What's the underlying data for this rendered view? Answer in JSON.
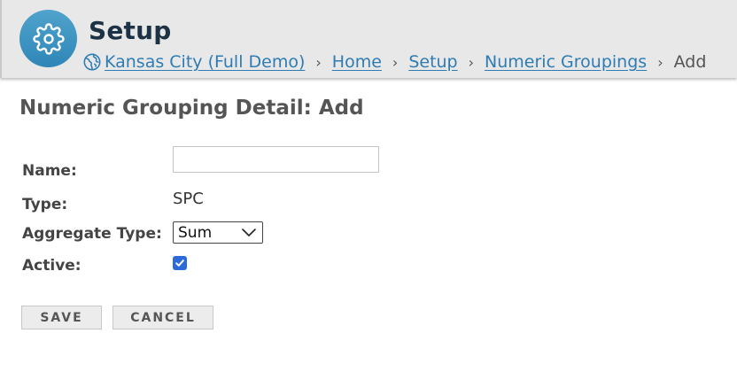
{
  "header": {
    "title": "Setup",
    "app_icon": "gear-icon",
    "breadcrumb": {
      "site_icon": "globe-icon",
      "links": [
        {
          "label": "Kansas City (Full Demo)"
        },
        {
          "label": "Home"
        },
        {
          "label": "Setup"
        },
        {
          "label": "Numeric Groupings"
        }
      ],
      "separator": "›",
      "current": "Add"
    }
  },
  "form": {
    "heading": "Numeric Grouping Detail: Add",
    "name": {
      "label": "Name:",
      "value": "",
      "placeholder": ""
    },
    "type": {
      "label": "Type:",
      "value": "SPC"
    },
    "aggregate_type": {
      "label": "Aggregate Type:",
      "selected": "Sum",
      "icon": "chevron-down-icon"
    },
    "active": {
      "label": "Active:",
      "checked": true,
      "icon": "checkmark-icon"
    }
  },
  "buttons": {
    "save": "SAVE",
    "cancel": "CANCEL"
  },
  "colors": {
    "header_bg": "#e8e8e8",
    "title": "#1e3246",
    "link": "#2e7cb3",
    "icon_circle": "#3a93c2",
    "checkbox": "#2d6ad8"
  }
}
